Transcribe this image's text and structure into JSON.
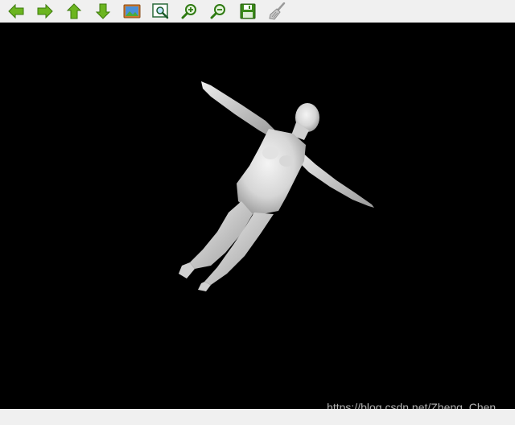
{
  "toolbar": {
    "buttons": [
      {
        "icon": "arrow-left-icon"
      },
      {
        "icon": "arrow-right-icon"
      },
      {
        "icon": "arrow-up-icon"
      },
      {
        "icon": "arrow-down-icon"
      },
      {
        "icon": "picture-icon"
      },
      {
        "icon": "zoom-fit-icon"
      },
      {
        "icon": "zoom-in-icon"
      },
      {
        "icon": "zoom-out-icon"
      },
      {
        "icon": "save-icon"
      },
      {
        "icon": "broom-icon"
      }
    ]
  },
  "viewport": {
    "background": "#000000",
    "model_color": "#e6e6e6",
    "watermark": "https://blog.csdn.net/Zheng_Chen_"
  },
  "colors": {
    "toolbar_bg": "#f0f0f0",
    "icon_green": "#5fa818",
    "icon_green_dark": "#3d7a0c"
  }
}
